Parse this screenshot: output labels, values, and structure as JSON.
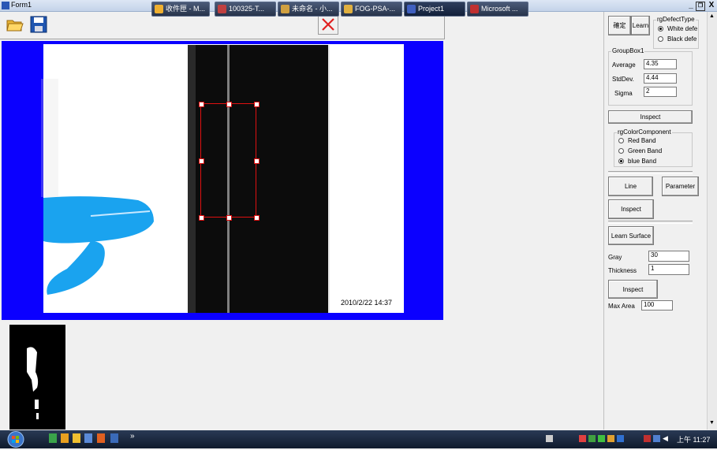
{
  "window": {
    "title": "Form1",
    "minimize": "_",
    "restore": "❐",
    "close": "X"
  },
  "toolbar": {
    "open_icon": "folder-open-icon",
    "save_icon": "floppy-save-icon",
    "delete_icon": "red-x-icon"
  },
  "image": {
    "timestamp": "2010/2/22 14:37"
  },
  "controls": {
    "confirm_label": "確定",
    "learn_label": "Learn",
    "defect_type": {
      "title": "rgDefectType",
      "options": [
        "White defe",
        "Black defe"
      ],
      "selected": 0
    },
    "groupbox1": {
      "title": "GroupBox1",
      "average_label": "Average",
      "average_value": "4.35",
      "stddev_label": "StdDev.",
      "stddev_value": "4.44",
      "sigma_label": "Sigma",
      "sigma_value": "2"
    },
    "inspect1_label": "Inspect",
    "color_component": {
      "title": "rgColorComponent",
      "options": [
        "Red Band",
        "Green Band",
        "blue Band"
      ],
      "selected": 2
    },
    "line_label": "Line",
    "parameter_label": "Parameter",
    "inspect2_label": "Inspect",
    "learn_surface_label": "Learn Surface",
    "gray_label": "Gray",
    "gray_value": "30",
    "thickness_label": "Thickness",
    "thickness_value": "1",
    "inspect3_label": "Inspect",
    "max_area_label": "Max Area",
    "max_area_value": "100"
  },
  "taskbar": {
    "start_icon": "windows-orb-icon",
    "tasks": [
      "收件匣 - M...",
      "100325-T...",
      "未命名 - 小...",
      "FOG-PSA-...",
      "Project1",
      "Microsoft ..."
    ],
    "active_task": 4,
    "clock": "上午 11:27"
  }
}
